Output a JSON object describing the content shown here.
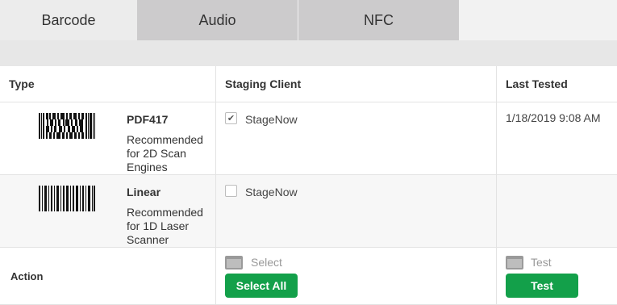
{
  "tabs": [
    {
      "label": "Barcode",
      "active": true
    },
    {
      "label": "Audio",
      "active": false
    },
    {
      "label": "NFC",
      "active": false
    }
  ],
  "table": {
    "headers": {
      "type": "Type",
      "staging_client": "Staging Client",
      "last_tested": "Last Tested"
    },
    "rows": [
      {
        "barcode_icon": "pdf417-barcode-icon",
        "name": "PDF417",
        "description": "Recommended for 2D Scan Engines",
        "client_label": "StageNow",
        "checked": true,
        "last_tested": "1/18/2019 9:08 AM"
      },
      {
        "barcode_icon": "linear-barcode-icon",
        "name": "Linear",
        "description": "Recommended for 1D Laser Scanner",
        "client_label": "StageNow",
        "checked": false,
        "last_tested": ""
      }
    ],
    "action": {
      "label": "Action",
      "select_label": "Select",
      "select_all_button": "Select All",
      "test_label": "Test",
      "test_button": "Test"
    }
  },
  "colors": {
    "accent_green": "#13a04a",
    "tab_inactive": "#cccbcc",
    "tab_active": "#ececec"
  }
}
